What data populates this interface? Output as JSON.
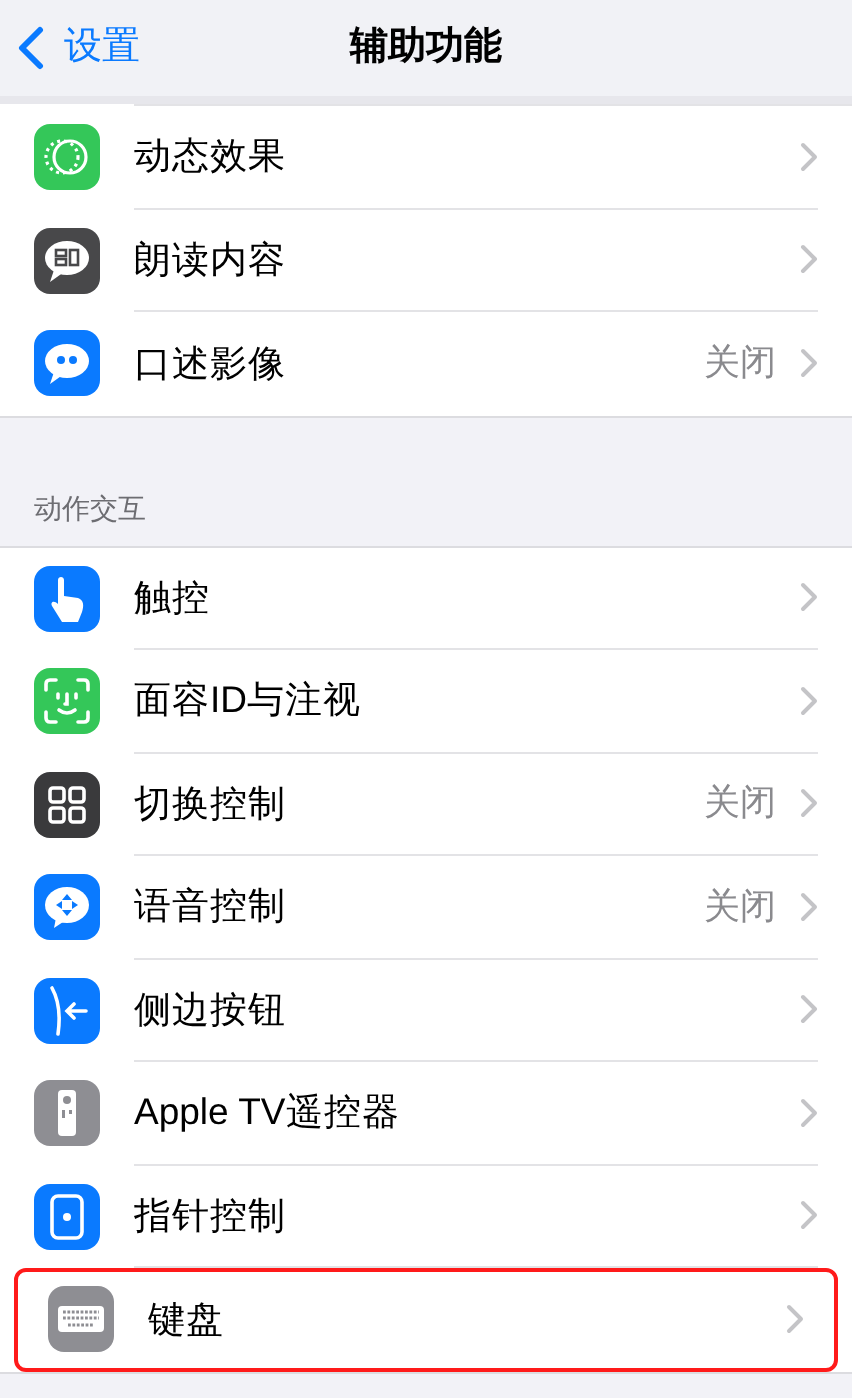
{
  "nav": {
    "back": "设置",
    "title": "辅助功能"
  },
  "sections": [
    {
      "items": [
        {
          "label": "动态效果",
          "highlighted": false
        },
        {
          "label": "朗读内容",
          "highlighted": false
        },
        {
          "label": "口述影像",
          "value": "关闭",
          "highlighted": false
        }
      ]
    },
    {
      "header": "动作交互",
      "items": [
        {
          "label": "触控",
          "highlighted": false
        },
        {
          "label": "面容ID与注视",
          "highlighted": false
        },
        {
          "label": "切换控制",
          "value": "关闭",
          "highlighted": false
        },
        {
          "label": "语音控制",
          "value": "关闭",
          "highlighted": false
        },
        {
          "label": "侧边按钮",
          "highlighted": false
        },
        {
          "label": "Apple TV遥控器",
          "highlighted": false
        },
        {
          "label": "指针控制",
          "highlighted": false
        },
        {
          "label": "键盘",
          "highlighted": true
        }
      ]
    }
  ]
}
